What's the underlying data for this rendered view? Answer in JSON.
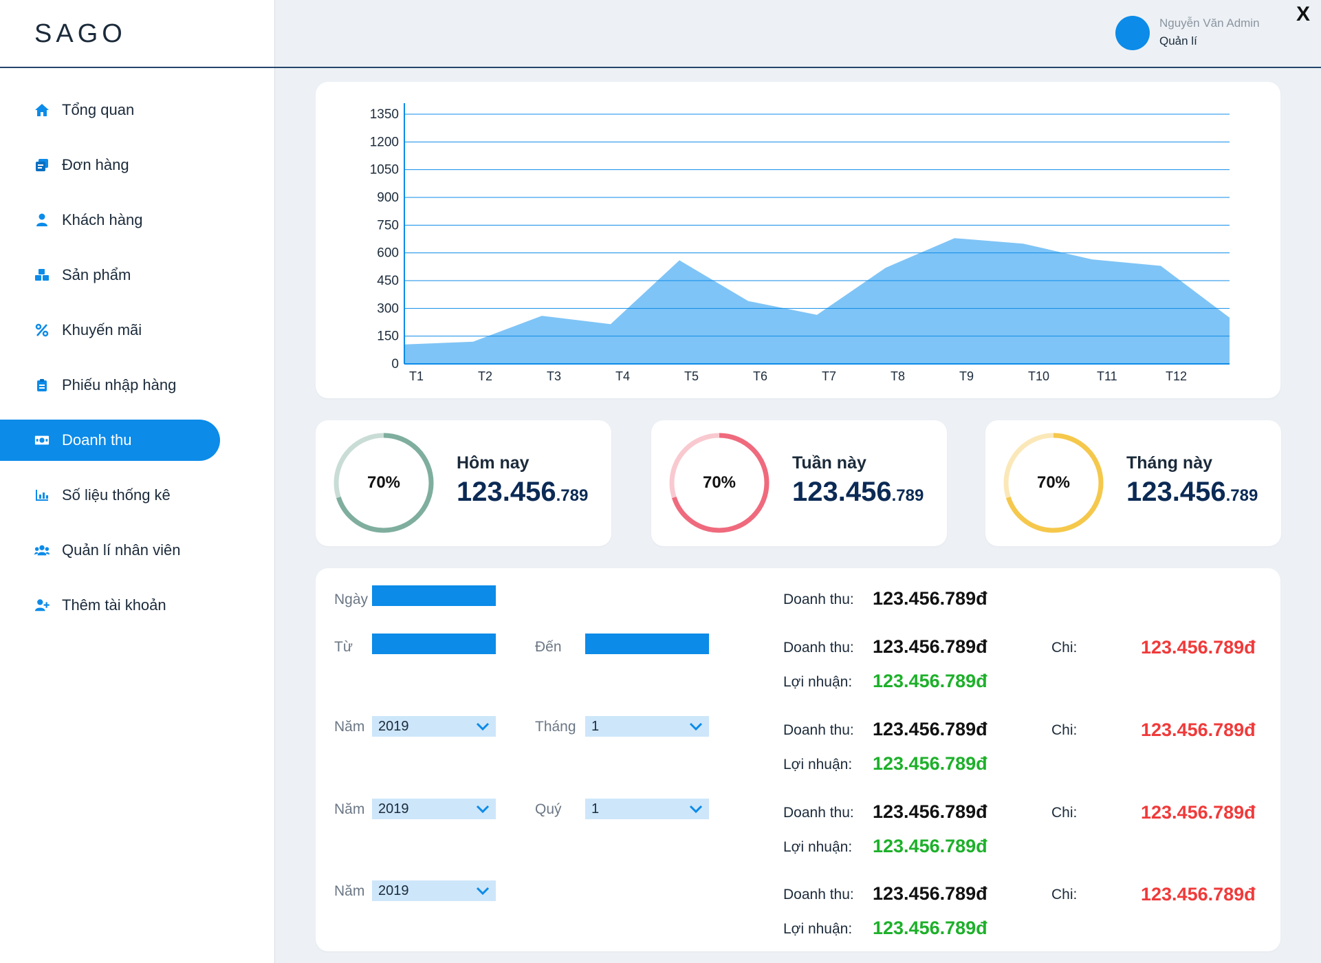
{
  "app": {
    "logo": "SAGO",
    "close_symbol": "X"
  },
  "user": {
    "name": "Nguyễn Văn Admin",
    "role": "Quản lí"
  },
  "sidebar": {
    "items": [
      {
        "label": "Tổng quan",
        "icon": "home-icon"
      },
      {
        "label": "Đơn hàng",
        "icon": "orders-icon"
      },
      {
        "label": "Khách hàng",
        "icon": "user-icon"
      },
      {
        "label": "Sản phẩm",
        "icon": "boxes-icon"
      },
      {
        "label": "Khuyến mãi",
        "icon": "percent-icon"
      },
      {
        "label": "Phiếu nhập hàng",
        "icon": "clipboard-icon"
      },
      {
        "label": "Doanh thu",
        "icon": "money-icon",
        "active": true
      },
      {
        "label": "Số liệu thống kê",
        "icon": "bar-chart-icon"
      },
      {
        "label": "Quản lí nhân viên",
        "icon": "users-icon"
      },
      {
        "label": "Thêm tài khoản",
        "icon": "user-plus-icon"
      }
    ]
  },
  "chart_data": {
    "type": "area",
    "categories": [
      "T1",
      "T2",
      "T3",
      "T4",
      "T5",
      "T6",
      "T7",
      "T8",
      "T9",
      "T10",
      "T11",
      "T12"
    ],
    "values": [
      105,
      120,
      260,
      215,
      560,
      340,
      265,
      520,
      680,
      650,
      565,
      530,
      250
    ],
    "y_ticks": [
      0,
      150,
      300,
      450,
      600,
      750,
      900,
      1050,
      1200,
      1350
    ],
    "ylim": [
      0,
      1350
    ],
    "grid": true,
    "fill_color": "#7fc4f6",
    "grid_color": "#0c8be8"
  },
  "stats": [
    {
      "title": "Hôm nay",
      "percent_label": "70%",
      "percent": 0.7,
      "value_main": "123.456",
      "value_small": ".789",
      "ring_color": "#7fae9e",
      "ring_bg": "#c9ddd6"
    },
    {
      "title": "Tuần này",
      "percent_label": "70%",
      "percent": 0.7,
      "value_main": "123.456",
      "value_small": ".789",
      "ring_color": "#ef6a7d",
      "ring_bg": "#f9c9d0"
    },
    {
      "title": "Tháng này",
      "percent_label": "70%",
      "percent": 0.7,
      "value_main": "123.456",
      "value_small": ".789",
      "ring_color": "#f5c84c",
      "ring_bg": "#fbe8b9"
    }
  ],
  "filters": {
    "ngay_label": "Ngày",
    "tu_label": "Từ",
    "den_label": "Đến",
    "nam_label": "Năm",
    "thang_label": "Tháng",
    "quy_label": "Quý",
    "year_value": "2019",
    "month_value": "1",
    "quarter_value": "1"
  },
  "results": {
    "revenue_label": "Doanh thu:",
    "expense_label": "Chi:",
    "profit_label": "Lợi nhuận:",
    "amount": "123.456.789đ"
  }
}
